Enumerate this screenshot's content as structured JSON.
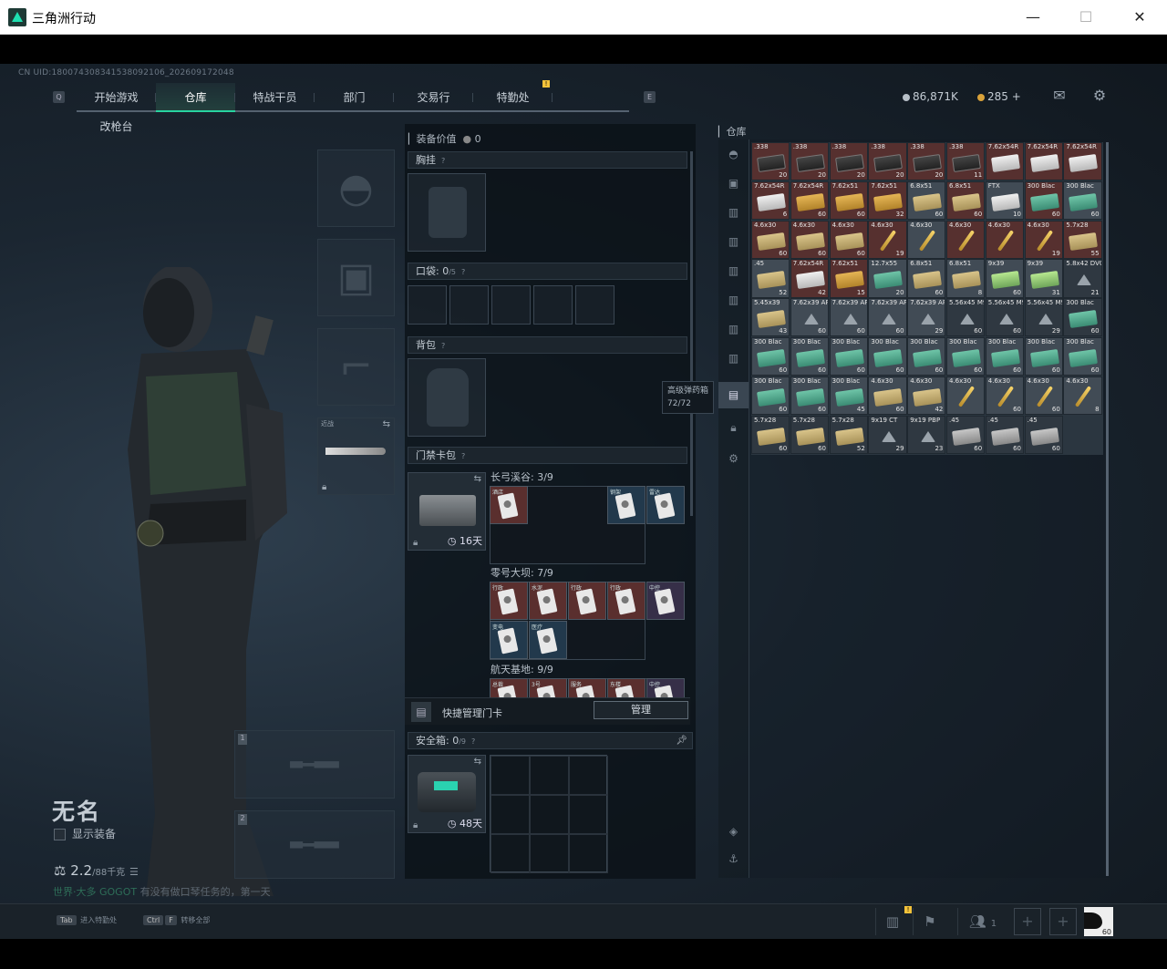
{
  "window": {
    "title": "三角洲行动",
    "min": "—",
    "max": "☐",
    "close": "✕"
  },
  "uid": "CN UID:18007430834153809210​6_2026091720​48",
  "nav": {
    "left_key": "Q",
    "right_key": "E",
    "tabs": [
      "开始游戏",
      "仓库",
      "特战干员",
      "部门",
      "交易行",
      "特勤处",
      "改枪台"
    ],
    "active": 1,
    "badge": "!"
  },
  "currency": {
    "coins": "86,871K",
    "bonds": "285",
    "plus": "+"
  },
  "character": {
    "name": "无名",
    "show_equip": "显示装备",
    "weight": "2.2",
    "weight_max": "/88千克",
    "melee_label": "近战",
    "chat_channel": "世界·大多",
    "chat_user": "GOGOT",
    "chat_text": "有没有做口琴任务的，第一天"
  },
  "weapon_slots": [
    "1",
    "2"
  ],
  "equip": {
    "value_label": "装备价值",
    "value": "0",
    "chest": "胸挂",
    "pocket": "口袋:",
    "pocket_val": "0",
    "pocket_max": "/5",
    "backpack": "背包",
    "keycard": "门禁卡包",
    "keycard_days": "16天",
    "safe": "安全箱:",
    "safe_val": "0",
    "safe_max": "/9",
    "safe_days": "48天",
    "q": "?"
  },
  "keycards": [
    {
      "map": "长弓溪谷: 3/9",
      "cards": [
        {
          "color": "red",
          "title": "酒店"
        },
        {
          "color": "blue",
          "title": "钢架"
        },
        {
          "color": "blue",
          "title": "雷达"
        }
      ]
    },
    {
      "map": "零号大坝: 7/9",
      "cards": [
        {
          "color": "red",
          "title": "行政"
        },
        {
          "color": "red",
          "title": "水泥"
        },
        {
          "color": "red",
          "title": "行政"
        },
        {
          "color": "red",
          "title": "行政"
        },
        {
          "color": "purple",
          "title": "中控"
        },
        {
          "color": "blue",
          "title": "变电"
        },
        {
          "color": "blue",
          "title": "医疗"
        }
      ]
    },
    {
      "map": "航天基地: 9/9",
      "cards": [
        {
          "color": "red",
          "title": "总裁"
        },
        {
          "color": "red",
          "title": "3号"
        },
        {
          "color": "red",
          "title": "服务"
        },
        {
          "color": "red",
          "title": "东楼"
        },
        {
          "color": "purple",
          "title": "中控"
        }
      ]
    }
  ],
  "quick_keycard": {
    "label": "快捷管理门卡",
    "button": "管理"
  },
  "tooltip": {
    "name": "高级弹药箱",
    "count": "72/72"
  },
  "warehouse": {
    "label": "仓库"
  },
  "items": [
    {
      "n": ".338",
      "c": "20",
      "b": "red",
      "s": "black"
    },
    {
      "n": ".338",
      "c": "20",
      "b": "red",
      "s": "black"
    },
    {
      "n": ".338",
      "c": "20",
      "b": "red",
      "s": "black"
    },
    {
      "n": ".338",
      "c": "20",
      "b": "red",
      "s": "black"
    },
    {
      "n": ".338",
      "c": "20",
      "b": "red",
      "s": "black"
    },
    {
      "n": ".338",
      "c": "11",
      "b": "red",
      "s": "black"
    },
    {
      "n": "7.62x54R",
      "c": "",
      "b": "red",
      "s": "white"
    },
    {
      "n": "7.62x54R",
      "c": "",
      "b": "red",
      "s": "white"
    },
    {
      "n": "7.62x54R",
      "c": "",
      "b": "red",
      "s": "white"
    },
    {
      "n": "7.62x54R",
      "c": "6",
      "b": "red",
      "s": "white"
    },
    {
      "n": "7.62x54R",
      "c": "60",
      "b": "red",
      "s": "orange"
    },
    {
      "n": "7.62x51",
      "c": "60",
      "b": "red",
      "s": "orange"
    },
    {
      "n": "7.62x51",
      "c": "32",
      "b": "red",
      "s": "orange"
    },
    {
      "n": "6.8x51",
      "c": "60",
      "b": "grey",
      "s": "tan"
    },
    {
      "n": "6.8x51",
      "c": "60",
      "b": "red",
      "s": "tan"
    },
    {
      "n": "FTX",
      "c": "10",
      "b": "grey",
      "s": "white"
    },
    {
      "n": "300 Blac",
      "c": "60",
      "b": "red",
      "s": "green"
    },
    {
      "n": "300 Blac",
      "c": "60",
      "b": "grey",
      "s": "green"
    },
    {
      "n": "4.6x30",
      "c": "60",
      "b": "red",
      "s": "tan"
    },
    {
      "n": "4.6x30",
      "c": "60",
      "b": "red",
      "s": "tan"
    },
    {
      "n": "4.6x30",
      "c": "60",
      "b": "red",
      "s": "tan"
    },
    {
      "n": "4.6x30",
      "c": "19",
      "b": "red",
      "s": "bullet"
    },
    {
      "n": "4.6x30",
      "c": "",
      "b": "grey",
      "s": "bullet"
    },
    {
      "n": "4.6x30",
      "c": "",
      "b": "red",
      "s": "bullet"
    },
    {
      "n": "4.6x30",
      "c": "",
      "b": "red",
      "s": "bullet"
    },
    {
      "n": "4.6x30",
      "c": "19",
      "b": "red",
      "s": "bullet"
    },
    {
      "n": "5.7x28",
      "c": "55",
      "b": "red",
      "s": "tan"
    },
    {
      "n": ".45",
      "c": "52",
      "b": "grey",
      "s": "tan"
    },
    {
      "n": "7.62x54R",
      "c": "42",
      "b": "red",
      "s": "white"
    },
    {
      "n": "7.62x51",
      "c": "15",
      "b": "red",
      "s": "orange"
    },
    {
      "n": "12.7x55",
      "c": "20",
      "b": "grey",
      "s": "green"
    },
    {
      "n": "6.8x51",
      "c": "60",
      "b": "grey",
      "s": "tan"
    },
    {
      "n": "6.8x51",
      "c": "8",
      "b": "grey",
      "s": "tan"
    },
    {
      "n": "9x39",
      "c": "60",
      "b": "grey",
      "s": "lime"
    },
    {
      "n": "9x39",
      "c": "31",
      "b": "grey",
      "s": "lime"
    },
    {
      "n": "5.8x42 DVC12",
      "c": "21",
      "b": "dark",
      "s": "tri"
    },
    {
      "n": "5.45x39",
      "c": "43",
      "b": "grey",
      "s": "tan"
    },
    {
      "n": "7.62x39 AP",
      "c": "60",
      "b": "grey",
      "s": "tri"
    },
    {
      "n": "7.62x39 AP",
      "c": "60",
      "b": "grey",
      "s": "tri"
    },
    {
      "n": "7.62x39 AP",
      "c": "60",
      "b": "grey",
      "s": "tri"
    },
    {
      "n": "7.62x39 AP",
      "c": "29",
      "b": "grey",
      "s": "tri"
    },
    {
      "n": "5.56x45 M995",
      "c": "60",
      "b": "dark",
      "s": "tri"
    },
    {
      "n": "5.56x45 M995",
      "c": "60",
      "b": "dark",
      "s": "tri"
    },
    {
      "n": "5.56x45 M995",
      "c": "29",
      "b": "dark",
      "s": "tri"
    },
    {
      "n": "300 Blac",
      "c": "60",
      "b": "dark",
      "s": "green"
    },
    {
      "n": "300 Blac",
      "c": "60",
      "b": "grey",
      "s": "green"
    },
    {
      "n": "300 Blac",
      "c": "60",
      "b": "grey",
      "s": "green"
    },
    {
      "n": "300 Blac",
      "c": "60",
      "b": "grey",
      "s": "green"
    },
    {
      "n": "300 Blac",
      "c": "60",
      "b": "grey",
      "s": "green"
    },
    {
      "n": "300 Blac",
      "c": "60",
      "b": "grey",
      "s": "green"
    },
    {
      "n": "300 Blac",
      "c": "60",
      "b": "grey",
      "s": "green"
    },
    {
      "n": "300 Blac",
      "c": "60",
      "b": "grey",
      "s": "green"
    },
    {
      "n": "300 Blac",
      "c": "60",
      "b": "grey",
      "s": "green"
    },
    {
      "n": "300 Blac",
      "c": "60",
      "b": "grey",
      "s": "green"
    },
    {
      "n": "300 Blac",
      "c": "60",
      "b": "grey",
      "s": "green"
    },
    {
      "n": "300 Blac",
      "c": "60",
      "b": "grey",
      "s": "green"
    },
    {
      "n": "300 Blac",
      "c": "45",
      "b": "grey",
      "s": "green"
    },
    {
      "n": "4.6x30",
      "c": "60",
      "b": "grey",
      "s": "tan"
    },
    {
      "n": "4.6x30",
      "c": "42",
      "b": "grey",
      "s": "tan"
    },
    {
      "n": "4.6x30",
      "c": "",
      "b": "grey",
      "s": "bullet"
    },
    {
      "n": "4.6x30",
      "c": "60",
      "b": "grey",
      "s": "bullet"
    },
    {
      "n": "4.6x30",
      "c": "60",
      "b": "grey",
      "s": "bullet"
    },
    {
      "n": "4.6x30",
      "c": "8",
      "b": "grey",
      "s": "bullet"
    },
    {
      "n": "5.7x28",
      "c": "60",
      "b": "dark",
      "s": "tan"
    },
    {
      "n": "5.7x28",
      "c": "60",
      "b": "dark",
      "s": "tan"
    },
    {
      "n": "5.7x28",
      "c": "52",
      "b": "dark",
      "s": "tan"
    },
    {
      "n": "9x19 CT",
      "c": "29",
      "b": "dark",
      "s": "tri"
    },
    {
      "n": "9x19 PBP",
      "c": "23",
      "b": "dark",
      "s": "tri"
    },
    {
      "n": ".45",
      "c": "60",
      "b": "dark",
      "s": "gray"
    },
    {
      "n": ".45",
      "c": "60",
      "b": "dark",
      "s": "gray"
    },
    {
      "n": ".45",
      "c": "60",
      "b": "dark",
      "s": "gray"
    },
    {
      "n": "",
      "c": "",
      "b": "empty",
      "s": ""
    }
  ],
  "bottom": {
    "tab_key": "Tab",
    "tab_hint": "进入特勤处",
    "ctrl_key": "Ctrl",
    "f_key": "F",
    "ctrl_hint": "转移全部",
    "party": "1",
    "badge": "!",
    "level": "60"
  }
}
